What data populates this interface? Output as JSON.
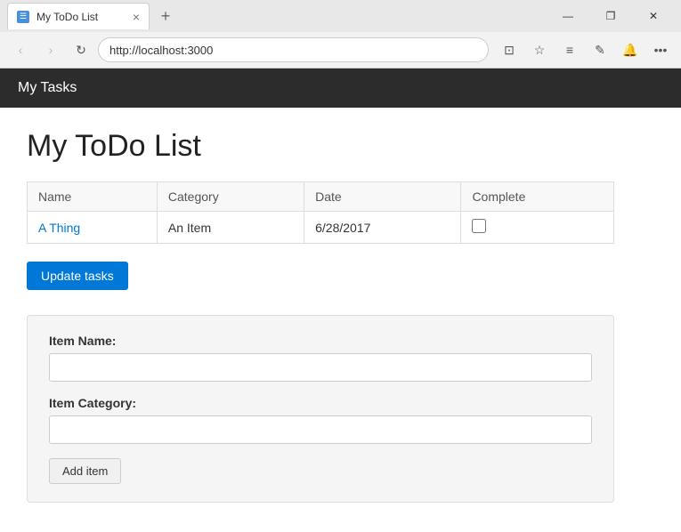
{
  "browser": {
    "tab_title": "My ToDo List",
    "tab_close": "×",
    "tab_new": "+",
    "address": "http://localhost:3000",
    "win_minimize": "—",
    "win_restore": "❐",
    "win_close": "✕",
    "nav_back": "‹",
    "nav_forward": "›",
    "nav_refresh": "↻"
  },
  "app": {
    "header_title": "My Tasks",
    "page_title": "My ToDo List"
  },
  "table": {
    "columns": [
      "Name",
      "Category",
      "Date",
      "Complete"
    ],
    "rows": [
      {
        "name": "A Thing",
        "category": "An Item",
        "date": "6/28/2017",
        "complete": false
      }
    ]
  },
  "buttons": {
    "update_tasks": "Update tasks",
    "add_item": "Add item"
  },
  "form": {
    "item_name_label": "Item Name:",
    "item_name_placeholder": "",
    "item_category_label": "Item Category:",
    "item_category_placeholder": ""
  }
}
